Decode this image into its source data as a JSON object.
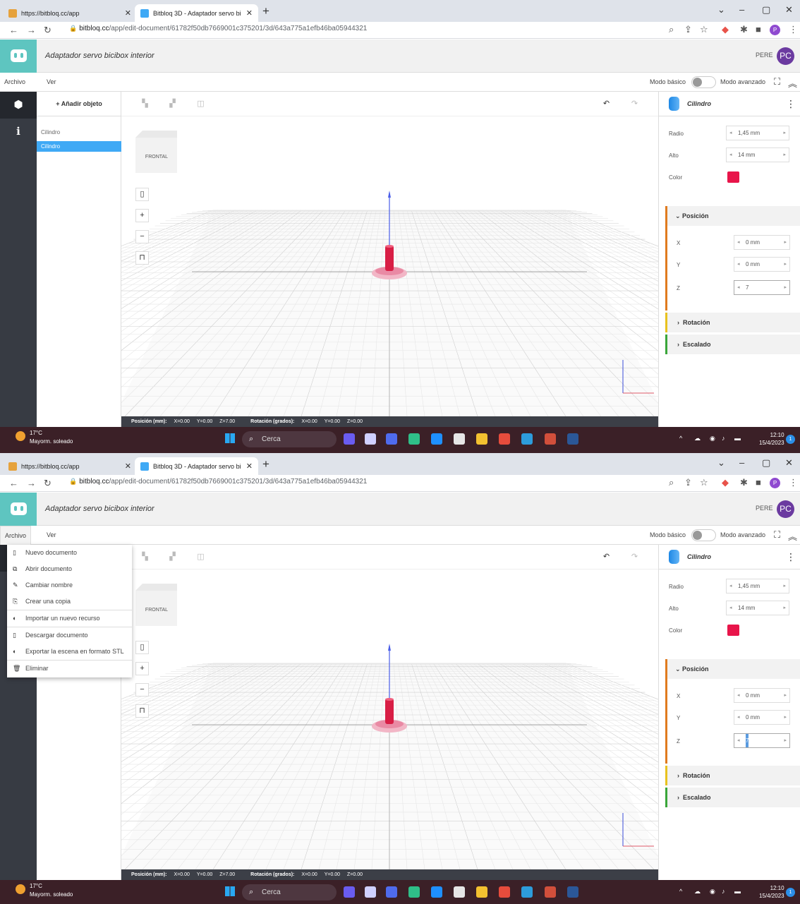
{
  "browser": {
    "tabs": [
      {
        "title": "https://bitbloq.cc/app",
        "active": false
      },
      {
        "title": "Bitbloq 3D - Adaptador servo bi",
        "active": true
      }
    ],
    "url_host": "bitbloq.cc",
    "url_path": "/app/edit-document/61782f50db7669001c375201/3d/643a775a1efb46ba05944321",
    "profile_initial": "P"
  },
  "app": {
    "document_title": "Adaptador servo bicibox interior",
    "user_name": "PERE",
    "user_initials": "PC",
    "menu": {
      "archivo": "Archivo",
      "ver": "Ver"
    },
    "mode_basic": "Modo básico",
    "mode_advanced": "Modo avanzado"
  },
  "objects": {
    "add_button": "+ Añadir objeto",
    "items": [
      "Cilindro",
      "Cilindro"
    ],
    "selected_index": 1
  },
  "viewport": {
    "cube_label": "FRONTAL",
    "status": {
      "pos_label": "Posición (mm):",
      "pos_x": "X=0.00",
      "pos_y": "Y=0.00",
      "pos_z": "Z=7.00",
      "rot_label": "Rotación (grados):",
      "rot_x": "X=0.00",
      "rot_y": "Y=0.00",
      "rot_z": "Z=0.00"
    }
  },
  "properties": {
    "object_name": "Cilindro",
    "radio_label": "Radio",
    "radio_value": "1,45 mm",
    "alto_label": "Alto",
    "alto_value": "14 mm",
    "color_label": "Color",
    "color_value": "#e8154a",
    "posicion": {
      "title": "Posición",
      "x_label": "X",
      "x_value": "0 mm",
      "y_label": "Y",
      "y_value": "0 mm",
      "z_label": "Z",
      "z_value": "7"
    },
    "rotacion": "Rotación",
    "escalado": "Escalado"
  },
  "archivo_menu": [
    {
      "label": "Nuevo documento",
      "icon": "new-doc-icon"
    },
    {
      "label": "Abrir documento",
      "icon": "open-doc-icon"
    },
    {
      "label": "Cambiar nombre",
      "icon": "pencil-icon"
    },
    {
      "label": "Crear una copia",
      "icon": "copy-icon"
    },
    {
      "label": "Importar un nuevo recurso",
      "icon": "import-icon"
    },
    {
      "label": "Descargar documento",
      "icon": "download-icon"
    },
    {
      "label": "Exportar la escena en formato STL",
      "icon": "export-icon"
    },
    {
      "label": "Eliminar",
      "icon": "trash-icon"
    }
  ],
  "taskbar": {
    "temperature": "17°C",
    "weather": "Mayorm. soleado",
    "search": "Cerca",
    "time": "12:10",
    "date": "15/4/2023",
    "notifications": "1"
  },
  "colors": {
    "accent_teal": "#5ec5c0",
    "selection_blue": "#3fa9f5",
    "position_orange": "#e07b1f",
    "rotation_yellow": "#e8c21f",
    "scale_green": "#3aa63a"
  }
}
